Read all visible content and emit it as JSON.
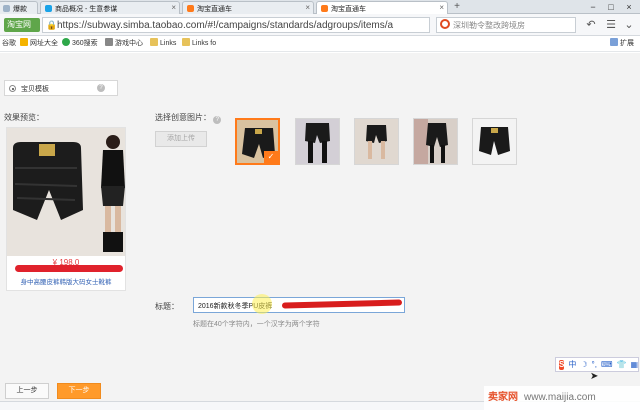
{
  "tabs": [
    {
      "label": "爆款",
      "active": false,
      "icon": "page-icon",
      "color": "#9fb3c8"
    },
    {
      "label": "商品概况 - 生意参谋",
      "active": false,
      "icon": "sycm-icon",
      "color": "#1aa3e8"
    },
    {
      "label": "淘宝直通车",
      "active": false,
      "icon": "ztc-icon",
      "color": "#ff7a1a"
    },
    {
      "label": "淘宝直通车",
      "active": true,
      "icon": "ztc-icon",
      "color": "#ff7a1a"
    }
  ],
  "browser": {
    "brand": "淘宝网",
    "url": "https://subway.simba.taobao.com/#!/campaigns/standards/adgroups/items/a",
    "search_placeholder": "深圳勒令整改跨境房",
    "extend_label": "扩展"
  },
  "bookmarks": [
    {
      "label": "谷歌",
      "icon": "google-icon"
    },
    {
      "label": "网址大全",
      "icon": "star-icon"
    },
    {
      "label": "360搜索",
      "icon": "360-icon"
    },
    {
      "label": "游戏中心",
      "icon": "game-icon"
    },
    {
      "label": "Links",
      "icon": "folder-icon"
    },
    {
      "label": "Links fo",
      "icon": "folder-icon"
    }
  ],
  "page": {
    "template_option": "宝贝模板",
    "preview_label": "效果预览：",
    "preview_price": "¥ 198.0",
    "preview_title": "身中高腰皮裤韩版大码女士靴裤",
    "pick_label": "选择创意图片：",
    "upload_button": "添加上传",
    "thumbnail_count": 5,
    "selected_thumbnail": 1,
    "title_label": "标题：",
    "title_value": "2016新款秋冬季PU皮裤",
    "title_hint": "标题在40个字符内，一个汉字为两个字符",
    "prev_button": "上一步",
    "next_button": "下一步"
  },
  "ime": {
    "logo": "S",
    "mode": "中"
  },
  "watermark": {
    "brand": "卖家网",
    "domain": "www.maijia.com"
  },
  "colors": {
    "accent": "#ff7a1a",
    "price": "#e4393c",
    "link": "#2f5fb3",
    "annotation": "#d81d1d"
  }
}
